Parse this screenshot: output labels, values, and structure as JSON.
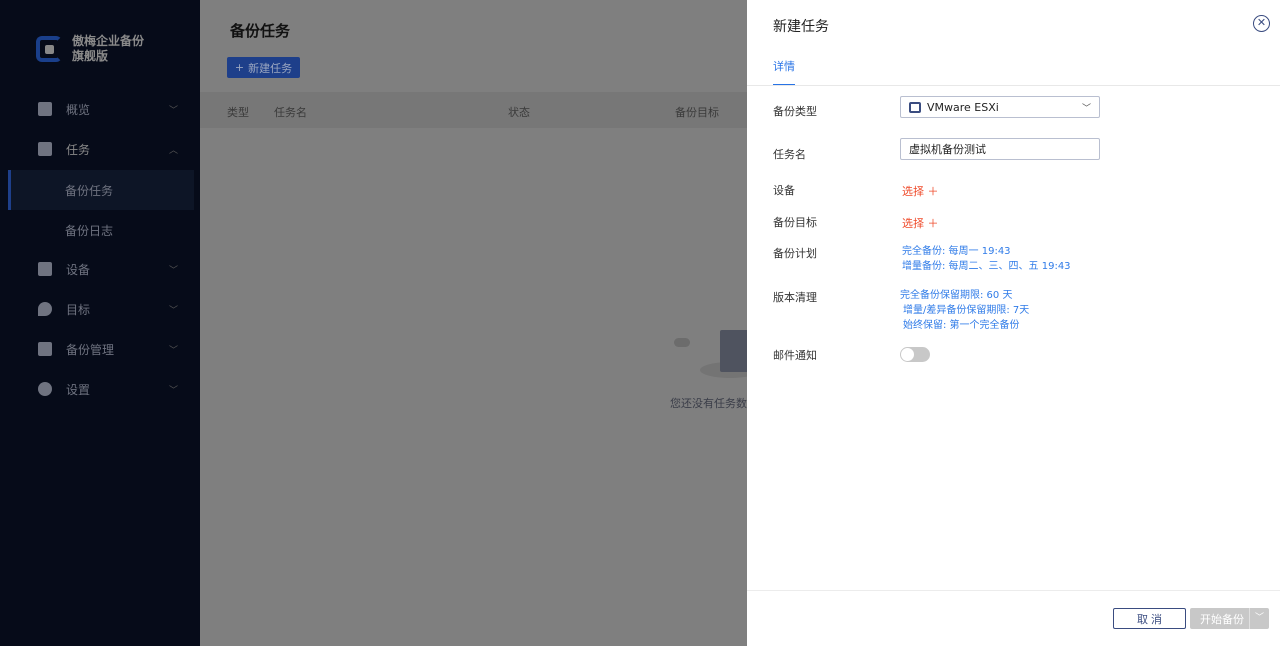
{
  "sidebar": {
    "brand_line1": "傲梅企业备份",
    "brand_line2": "旗舰版",
    "items": [
      {
        "label": "概览"
      },
      {
        "label": "任务"
      },
      {
        "label": "设备"
      },
      {
        "label": "目标"
      },
      {
        "label": "备份管理"
      },
      {
        "label": "设置"
      }
    ],
    "sub_items": [
      {
        "label": "备份任务"
      },
      {
        "label": "备份日志"
      }
    ]
  },
  "main": {
    "title": "备份任务",
    "new_task": "新建任务",
    "columns": [
      "类型",
      "任务名",
      "状态",
      "备份目标"
    ],
    "empty": "您还没有任务数据"
  },
  "panel": {
    "title": "新建任务",
    "tab": "详情",
    "labels": {
      "type": "备份类型",
      "name": "任务名",
      "device": "设备",
      "target": "备份目标",
      "plan": "备份计划",
      "cleanup": "版本清理",
      "email": "邮件通知"
    },
    "type_value": "VMware ESXi",
    "name_value": "虚拟机备份测试",
    "select": "选择",
    "plan": [
      "完全备份: 每周一 19:43",
      "增量备份: 每周二、三、四、五 19:43"
    ],
    "cleanup": [
      "完全备份保留期限: 60 天",
      "增量/差异备份保留期限: 7天",
      "始终保留: 第一个完全备份"
    ],
    "email_enabled": false,
    "cancel": "取 消",
    "start": "开始备份"
  }
}
